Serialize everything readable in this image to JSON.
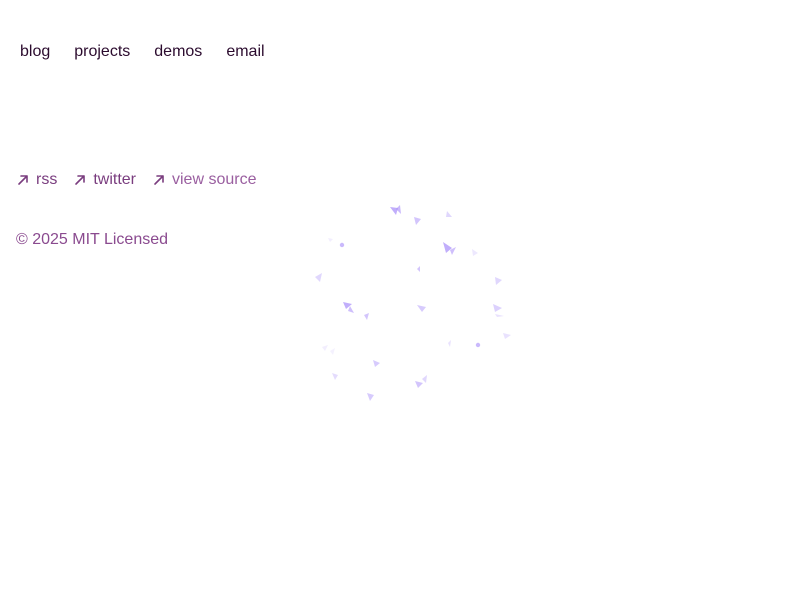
{
  "nav": {
    "items": [
      {
        "label": "blog"
      },
      {
        "label": "projects"
      },
      {
        "label": "demos"
      },
      {
        "label": "email"
      }
    ]
  },
  "footer": {
    "links": [
      {
        "label": "rss",
        "icon": "arrow-up-right-icon"
      },
      {
        "label": "twitter",
        "icon": "arrow-up-right-icon"
      },
      {
        "label": "view source",
        "icon": "arrow-up-right-icon"
      }
    ],
    "copyright": "© 2025 MIT Licensed"
  },
  "colors": {
    "nav_text": "#2b0b2e",
    "link_text": "#7a3d7f",
    "copyright_text": "#8a4a8f",
    "particles": "#a78bfa"
  }
}
